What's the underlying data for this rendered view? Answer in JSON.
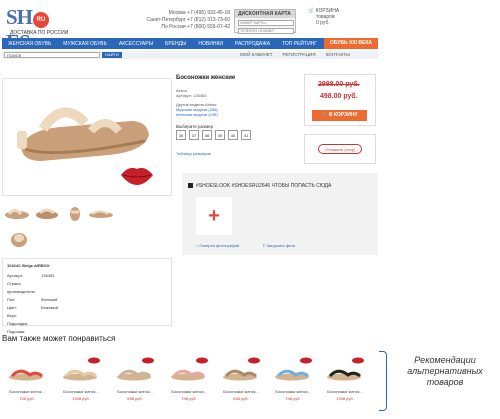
{
  "header": {
    "logo": "SH ES",
    "logo_ru": "RU",
    "tagline": "ДОСТАВКА ПО РОССИИ",
    "phones": [
      "Москва +7 (495) 933-45-18",
      "Санкт-Петербург +7 (812) 313-73-60",
      "По России +7 (800) 555-07-42"
    ],
    "discount_title": "ДИСКОНТНАЯ КАРТА",
    "discount_card_placeholder": "НОМЕР КАРТЫ",
    "discount_phone_placeholder": "ТЕЛЕФОН / Е-МАЙЛ",
    "cart_label": "КОРЗИНА",
    "cart_info": "товаров",
    "cart_sum": "0 руб."
  },
  "nav": [
    "ЖЕНСКАЯ ОБУВЬ",
    "МУЖСКАЯ ОБУВЬ",
    "АКСЕССУАРЫ",
    "БРЕНДЫ",
    "НОВИНКИ",
    "РАСПРОДАЖА",
    "ТОП РЕЙТИНГ"
  ],
  "nav_promo": "ОБУВЬ XXI ВЕКА",
  "search": {
    "value": "ПОИСК",
    "button": "НАЙТИ"
  },
  "account": [
    "МОЙ КАБИНЕТ",
    "РЕГИСТРАЦИЯ",
    "КОНТАКТЫ"
  ],
  "product": {
    "title": "Босоножки женские",
    "brand": "Airbox",
    "article": "Артикул: 135453",
    "others_label": "Другие модели Airbox:",
    "others": [
      "Мужские модели (268)",
      "Женские модели (195)"
    ],
    "sizes_label": "Выберите размер",
    "sizes": [
      "36",
      "37",
      "38",
      "39",
      "40",
      "41"
    ],
    "size_table": "Таблица размеров",
    "old_price": "2998.00 руб.",
    "new_price": "498.00 руб.",
    "buy": "В КОРЗИНУ",
    "ask": "Отложить (хочу)"
  },
  "specs": {
    "title": "10324C Beige AIRBOX",
    "rows": [
      [
        "Артикул:",
        "135453"
      ],
      [
        "Страна производитель:",
        ""
      ],
      [
        "Пол:",
        "Женский"
      ],
      [
        "Цвет:",
        "Бежевый"
      ],
      [
        "Верх:",
        ""
      ],
      [
        "Подкладка:",
        ""
      ],
      [
        "Подошва:",
        ""
      ]
    ]
  },
  "insta": {
    "head": "#SHOESLOOK #SHOESRU2646 ЧТОБЫ ПОПАСТЬ СЮДА",
    "plus": "+",
    "gallery": "Галерея фотографий",
    "upload": "Загрузить фото"
  },
  "recs": {
    "title": "Вам также может понравиться",
    "items": [
      {
        "name": "Босоножки женск...",
        "price": "798 руб.",
        "color": "#e8463a"
      },
      {
        "name": "Босоножки женск...",
        "price": "1398 руб.",
        "color": "#e6c9a5"
      },
      {
        "name": "Босоножки женск...",
        "price": "698 руб.",
        "color": "#c9b59a"
      },
      {
        "name": "Босоножки женск...",
        "price": "798 руб.",
        "color": "#e8a9a2"
      },
      {
        "name": "Босоножки женск...",
        "price": "698 руб.",
        "color": "#a88a6c"
      },
      {
        "name": "Босоножки женск...",
        "price": "798 руб.",
        "color": "#6fb0e0"
      },
      {
        "name": "Босоножки женск...",
        "price": "1398 руб.",
        "color": "#222222"
      }
    ]
  },
  "annotation": "Рекомендации альтернативных товаров"
}
